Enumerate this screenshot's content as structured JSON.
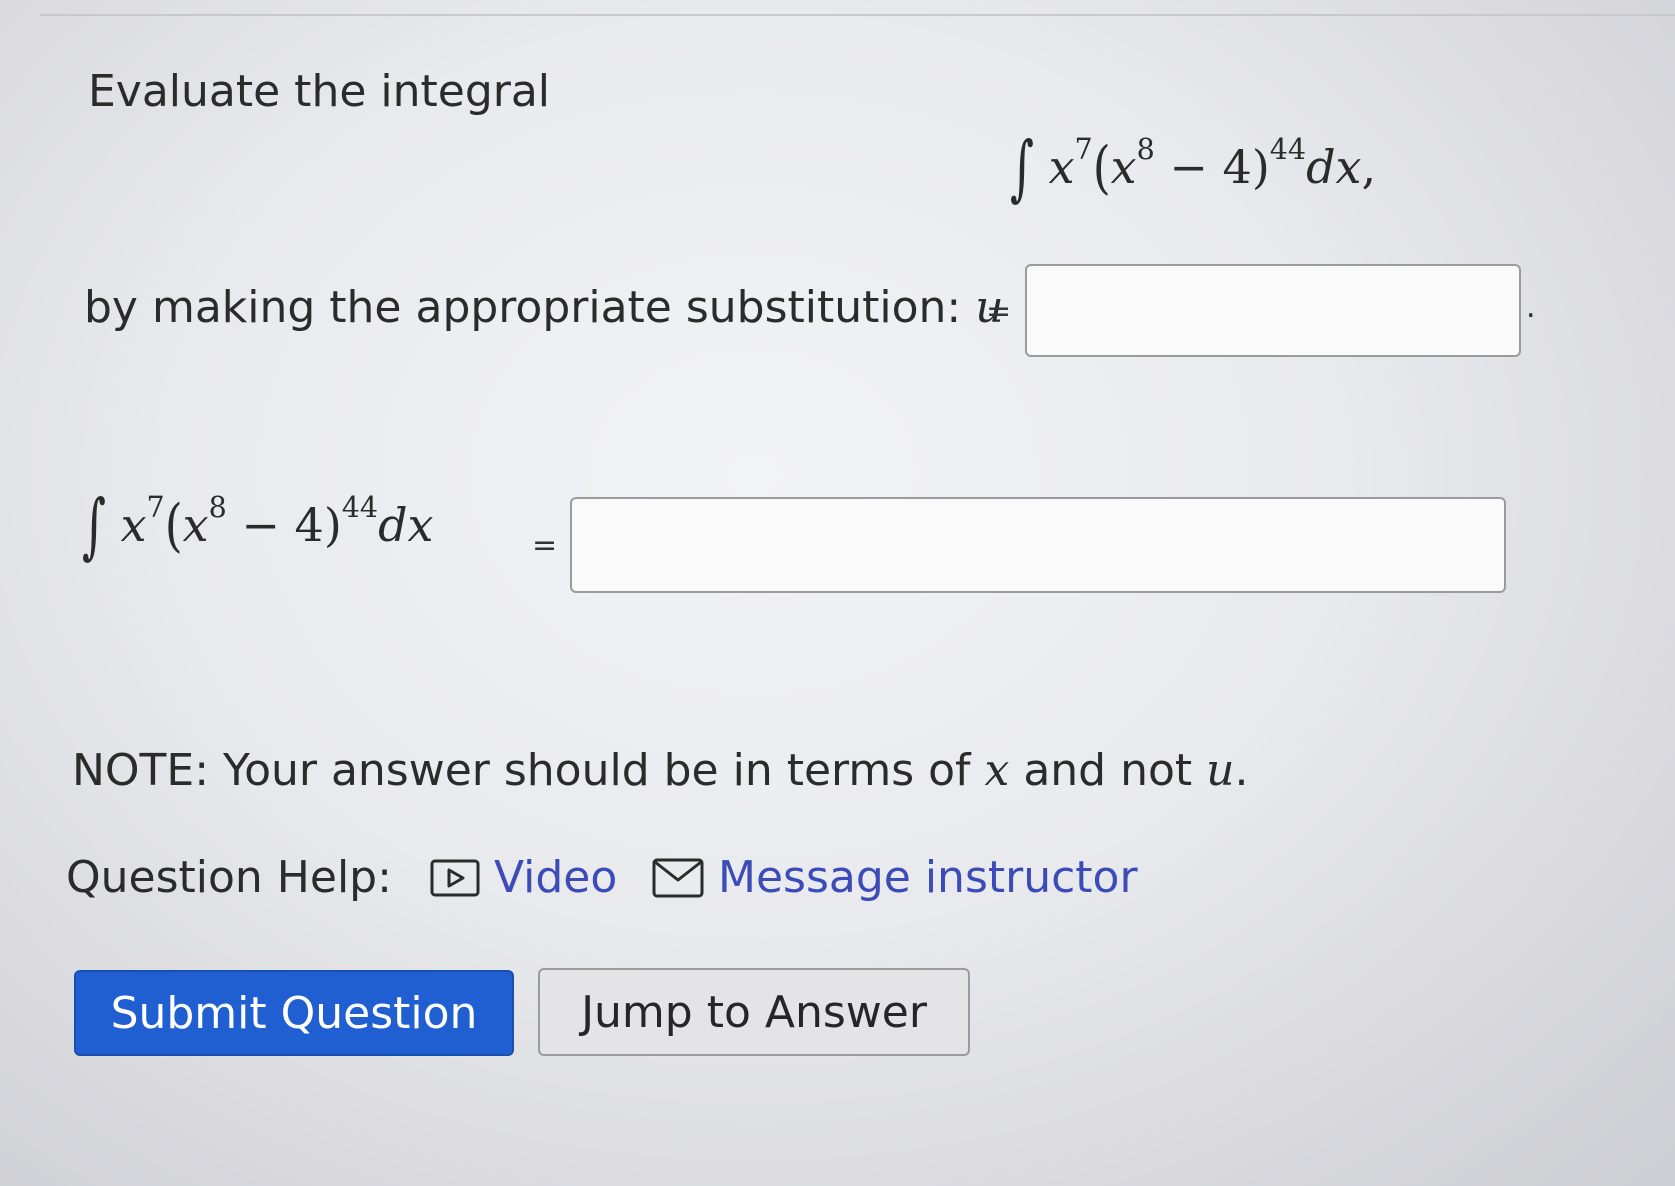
{
  "question": {
    "intro": "Evaluate the integral",
    "integrand": {
      "base_var": "x",
      "outer_exp": "7",
      "inner_exp": "8",
      "inner_rest": "− 4)",
      "power": "44",
      "differential": "dx",
      "trailing": ","
    },
    "substitution_label": "by making the appropriate substitution: ",
    "u_var": "u",
    "equals": "=",
    "period": ".",
    "u_input_value": "",
    "answer_input_value": "",
    "note_prefix": "NOTE: Your answer should be in terms of ",
    "note_x": "x",
    "note_mid": " and not ",
    "note_u": "u",
    "note_suffix": "."
  },
  "help": {
    "label": "Question Help:",
    "video_label": "Video",
    "video_icon": "video-play-icon",
    "message_label": "Message instructor",
    "message_icon": "envelope-icon"
  },
  "buttons": {
    "submit_label": "Submit Question",
    "jump_label": "Jump to Answer"
  },
  "colors": {
    "link": "#3b4cb8",
    "primary_button": "#1f5fd1",
    "secondary_button": "#e4e4e7"
  }
}
